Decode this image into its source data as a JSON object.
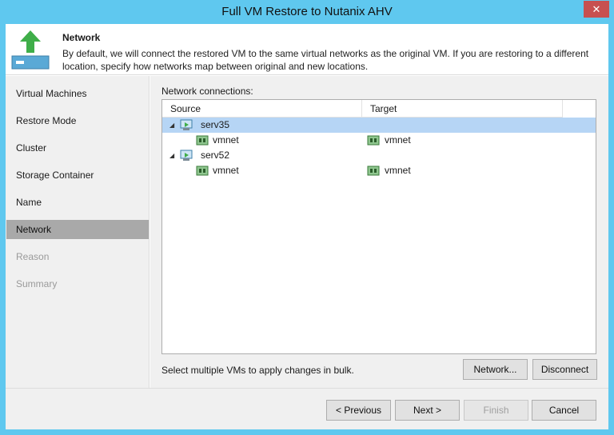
{
  "window": {
    "title": "Full VM Restore to Nutanix AHV",
    "close_label": "✕"
  },
  "header": {
    "title": "Network",
    "description": "By default, we will connect the restored VM to the same virtual networks as the original VM. If you are restoring to a different location, specify how networks map between original and new locations."
  },
  "sidebar": {
    "items": [
      {
        "label": "Virtual Machines",
        "state": "normal"
      },
      {
        "label": "Restore Mode",
        "state": "normal"
      },
      {
        "label": "Cluster",
        "state": "normal"
      },
      {
        "label": "Storage Container",
        "state": "normal"
      },
      {
        "label": "Name",
        "state": "normal"
      },
      {
        "label": "Network",
        "state": "active"
      },
      {
        "label": "Reason",
        "state": "disabled"
      },
      {
        "label": "Summary",
        "state": "disabled"
      }
    ]
  },
  "main": {
    "network_connections_label": "Network connections:",
    "columns": {
      "source": "Source",
      "target": "Target"
    },
    "rows": [
      {
        "type": "vm",
        "source": "serv35",
        "target": "",
        "selected": true
      },
      {
        "type": "net",
        "source": "vmnet",
        "target": "vmnet",
        "selected": false
      },
      {
        "type": "vm",
        "source": "serv52",
        "target": "",
        "selected": false
      },
      {
        "type": "net",
        "source": "vmnet",
        "target": "vmnet",
        "selected": false
      }
    ],
    "bulk_hint": "Select multiple VMs to apply changes in bulk.",
    "network_button": "Network...",
    "disconnect_button": "Disconnect"
  },
  "footer": {
    "previous": "< Previous",
    "next": "Next >",
    "finish": "Finish",
    "cancel": "Cancel"
  },
  "colors": {
    "titlebar": "#5fc8ef",
    "selection": "#b6d5f5",
    "active_step": "#a9a9a9",
    "close": "#c75050"
  }
}
